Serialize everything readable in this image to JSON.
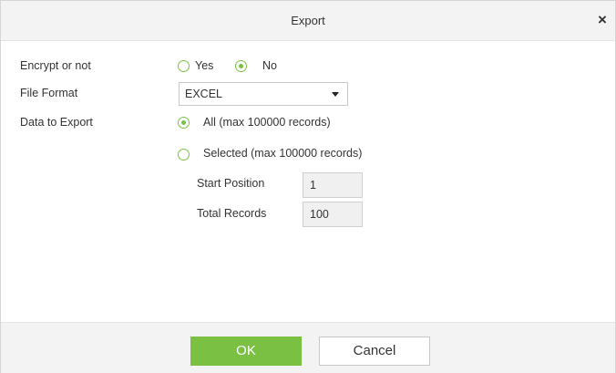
{
  "dialog": {
    "title": "Export",
    "close_icon": "close-icon",
    "close_glyph": "×"
  },
  "form": {
    "encrypt": {
      "label": "Encrypt or not",
      "options": [
        {
          "label": "Yes",
          "checked": false
        },
        {
          "label": "No",
          "checked": true
        }
      ]
    },
    "file_format": {
      "label": "File Format",
      "value": "EXCEL"
    },
    "data_to_export": {
      "label": "Data to Export",
      "options": [
        {
          "label": "All (max 100000 records)",
          "checked": true
        },
        {
          "label": "Selected (max 100000 records)",
          "checked": false
        }
      ],
      "start_position": {
        "label": "Start Position",
        "value": "1"
      },
      "total_records": {
        "label": "Total Records",
        "value": "100"
      }
    }
  },
  "footer": {
    "ok_label": "OK",
    "cancel_label": "Cancel"
  },
  "colors": {
    "accent": "#7ac143",
    "titlebar_bg": "#f3f3f3"
  }
}
